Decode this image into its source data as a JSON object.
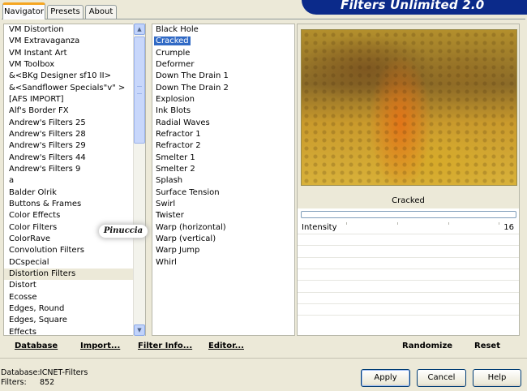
{
  "tabs": [
    "Navigator",
    "Presets",
    "About"
  ],
  "active_tab": "Navigator",
  "banner_title": "Filters Unlimited 2.0",
  "categories": [
    "VM Distortion",
    "VM Extravaganza",
    "VM Instant Art",
    "VM Toolbox",
    "&<BKg Designer sf10 II>",
    "&<Sandflower Specials\"v\" >",
    "[AFS IMPORT]",
    "Alf's Border FX",
    "Andrew's Filters 25",
    "Andrew's Filters 28",
    "Andrew's Filters 29",
    "Andrew's Filters 44",
    "Andrew's Filters 9",
    "a",
    "Balder Olrik",
    "Buttons & Frames",
    "Color Effects",
    "Color Filters",
    "ColorRave",
    "Convolution Filters",
    "DCspecial",
    "Distortion Filters",
    "Distort",
    "Ecosse",
    "Edges, Round",
    "Edges, Square",
    "Effects"
  ],
  "selected_category": "Distortion Filters",
  "filters": [
    "Black Hole",
    "Cracked",
    "Crumple",
    "Deformer",
    "Down The Drain 1",
    "Down The Drain 2",
    "Explosion",
    "Ink Blots",
    "Radial Waves",
    "Refractor 1",
    "Refractor 2",
    "Smelter 1",
    "Smelter 2",
    "Splash",
    "Surface Tension",
    "Swirl",
    "Twister",
    "Warp (horizontal)",
    "Warp (vertical)",
    "Warp Jump",
    "Whirl"
  ],
  "selected_filter": "Cracked",
  "preview": {
    "filter_name": "Cracked",
    "progress": 0
  },
  "controls": [
    {
      "label": "Intensity",
      "value": "16"
    }
  ],
  "bottom_links": {
    "database": "Database",
    "import": "Import...",
    "filter_info": "Filter Info...",
    "editor": "Editor...",
    "randomize": "Randomize",
    "reset": "Reset"
  },
  "status": {
    "database_label": "Database:",
    "database_value": "ICNET-Filters",
    "filters_label": "Filters:",
    "filters_value": "852"
  },
  "buttons": {
    "apply": "Apply",
    "cancel": "Cancel",
    "help": "Help"
  },
  "watermark": "Pinuccia",
  "icons": {
    "scroll_up": "arrow-up-icon",
    "scroll_down": "arrow-down-icon"
  },
  "colors": {
    "banner": "#0b2a8a",
    "selection": "#316ac5",
    "tab_accent": "#f5a623"
  }
}
